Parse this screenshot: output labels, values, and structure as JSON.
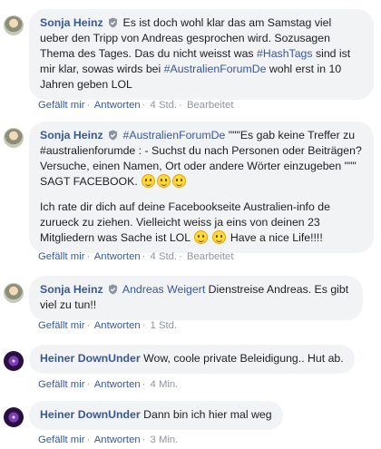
{
  "comments": [
    {
      "author": "Sonja Heinz",
      "text_a": "Es ist doch wohl klar das am Samstag viel ueber den Tripp von Andreas gesprochen wird. Sozusagen Thema des Tages. Das du nicht weisst was ",
      "tag1": "#HashTags",
      "text_b": " sind ist mir klar, sowas wirds bei ",
      "tag2": "#AustralienForumDe",
      "text_c": " wohl erst in 10 Jahren geben LOL",
      "like": "Gefällt mir",
      "reply": "Antworten",
      "time": "4 Std.",
      "edited": "Bearbeitet"
    },
    {
      "author": "Sonja Heinz",
      "tag": "#AustralienForumDe",
      "text_a": " \"\"\"Es gab keine Treffer zu #australienforumde : - Suchst du nach Personen oder Beiträgen? Versuche, einen Namen, Ort oder andere Wörter einzugeben \"\"\" SAGT FACEBOOK.",
      "text_b": "Ich rate dir dich auf deine Facebookseite Australien-info de zurueck zu ziehen. Vielleicht weiss ja eins von deinen 23 Mitgliedern was Sache ist LOL",
      "text_c": "Have a nice Life!!!!",
      "like": "Gefällt mir",
      "reply": "Antworten",
      "time": "4 Std.",
      "edited": "Bearbeitet"
    },
    {
      "author": "Sonja Heinz",
      "mention": "Andreas Weigert",
      "text": " Dienstreise Andreas. Es gibt viel zu tun!!",
      "like": "Gefällt mir",
      "reply": "Antworten",
      "time": "1 Std."
    },
    {
      "author": "Heiner DownUnder",
      "text": " Wow, coole private Beleidigung.. Hut ab.",
      "like": "Gefällt mir",
      "reply": "Antworten",
      "time": "4 Min."
    },
    {
      "author": "Heiner DownUnder",
      "text": " Dann bin ich hier mal weg",
      "like": "Gefällt mir",
      "reply": "Antworten",
      "time": "3 Min."
    }
  ],
  "separator": "·",
  "icons": {
    "badge": "shield-badge-icon",
    "emoji": "smiley-emoji-icon"
  },
  "colors": {
    "link": "#385898",
    "bubble": "#f2f3f5",
    "meta": "#90949c"
  }
}
